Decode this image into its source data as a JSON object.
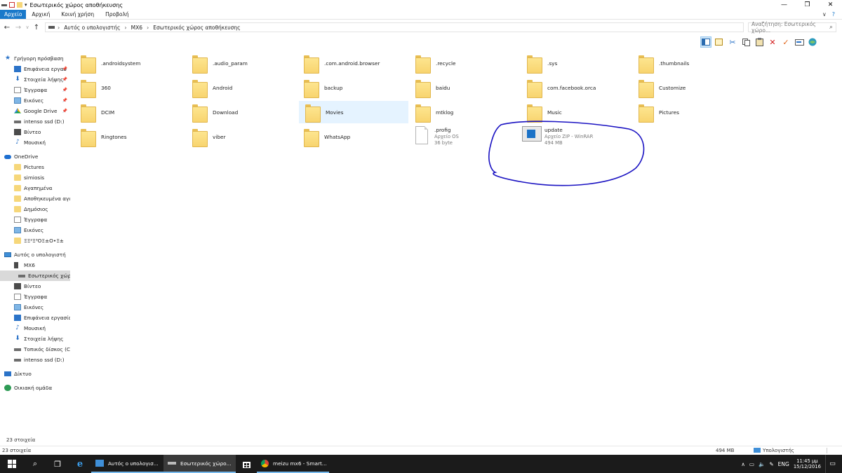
{
  "window": {
    "title": "Εσωτερικός χώρος αποθήκευσης",
    "minimize": "—",
    "maximize": "❐",
    "close": "✕"
  },
  "ribbon": {
    "tabs": [
      {
        "label": "Αρχείο"
      },
      {
        "label": "Αρχική"
      },
      {
        "label": "Κοινή χρήση"
      },
      {
        "label": "Προβολή"
      }
    ],
    "expand": "∨",
    "help": "?"
  },
  "navigation": {
    "back": "←",
    "forward": "→",
    "recent": "∨",
    "up": "↑"
  },
  "address": {
    "crumbs": [
      "Αυτός ο υπολογιστής",
      "MX6",
      "Εσωτερικός χώρος αποθήκευσης"
    ],
    "separator": "›"
  },
  "search": {
    "placeholder": "Αναζήτηση: Εσωτερικός χώρο...",
    "icon": "⌕"
  },
  "sidebar": {
    "quick_access": "Γρήγορη πρόσβαση",
    "items": [
      {
        "label": "Επιφάνεια εργασ",
        "pinned": true
      },
      {
        "label": "Στοιχεία λήψης",
        "pinned": true
      },
      {
        "label": "Έγγραφα",
        "pinned": true
      },
      {
        "label": "Εικόνες",
        "pinned": true
      },
      {
        "label": "Google Drive",
        "pinned": true
      },
      {
        "label": "intenso ssd (D:)"
      },
      {
        "label": "Βίντεο"
      },
      {
        "label": "Μουσική"
      }
    ],
    "onedrive": "OneDrive",
    "onedrive_items": [
      {
        "label": "Pictures"
      },
      {
        "label": "simiosis"
      },
      {
        "label": "Αγαπημένα"
      },
      {
        "label": "Αποθηκευμένα αγα"
      },
      {
        "label": "Δημόσιος"
      },
      {
        "label": "Έγγραφα"
      },
      {
        "label": "Εικόνες"
      },
      {
        "label": "ΞΞ²Ξ³ΟΞ±Ο•Ξ±"
      }
    ],
    "this_pc": "Αυτός ο υπολογιστή",
    "mx6": "MX6",
    "internal_storage": "Εσωτερικός χώρο",
    "pc_items": [
      {
        "label": "Βίντεο"
      },
      {
        "label": "Έγγραφα"
      },
      {
        "label": "Εικόνες"
      },
      {
        "label": "Επιφάνεια εργασίας"
      },
      {
        "label": "Μουσική"
      },
      {
        "label": "Στοιχεία λήψης"
      },
      {
        "label": "Τοπικός δίσκος (C:)"
      },
      {
        "label": "intenso ssd (D:)"
      }
    ],
    "network": "Δίκτυο",
    "homegroup": "Οικιακή ομάδα",
    "pin_glyph": "📌"
  },
  "files": [
    {
      "name": ".androidsystem",
      "kind": "folder"
    },
    {
      "name": ".audio_param",
      "kind": "folder"
    },
    {
      "name": ".com.android.browser",
      "kind": "folder"
    },
    {
      "name": ".recycle",
      "kind": "folder"
    },
    {
      "name": ".sys",
      "kind": "folder"
    },
    {
      "name": ".thumbnails",
      "kind": "folder"
    },
    {
      "name": "360",
      "kind": "folder"
    },
    {
      "name": "Android",
      "kind": "folder"
    },
    {
      "name": "backup",
      "kind": "folder"
    },
    {
      "name": "baidu",
      "kind": "folder"
    },
    {
      "name": "com.facebook.orca",
      "kind": "folder"
    },
    {
      "name": "Customize",
      "kind": "folder"
    },
    {
      "name": "DCIM",
      "kind": "folder"
    },
    {
      "name": "Download",
      "kind": "folder"
    },
    {
      "name": "Movies",
      "kind": "folder",
      "highlighted": true
    },
    {
      "name": "mtklog",
      "kind": "folder"
    },
    {
      "name": "Music",
      "kind": "folder"
    },
    {
      "name": "Pictures",
      "kind": "folder"
    },
    {
      "name": "Ringtones",
      "kind": "folder"
    },
    {
      "name": "viber",
      "kind": "folder"
    },
    {
      "name": "WhatsApp",
      "kind": "folder"
    },
    {
      "name": ".profig",
      "kind": "file",
      "type": "Αρχείο OS",
      "size": "36 byte"
    },
    {
      "name": "update",
      "kind": "rar",
      "type": "Αρχείο ZIP - WinRAR",
      "size": "494 MB"
    }
  ],
  "status": {
    "count_top": "23 στοιχεία",
    "count_bottom": "23 στοιχεία",
    "size": "494 MB",
    "location": "Υπολογιστής"
  },
  "taskbar": {
    "tasks": [
      {
        "label": "Αυτός ο υπολογισ..."
      },
      {
        "label": "Εσωτερικός χώρο..."
      },
      {
        "label": ""
      },
      {
        "label": "meizu mx6 - Smart..."
      }
    ],
    "search_glyph": "⌕",
    "taskview_glyph": "❐",
    "language": "ENG",
    "time": "11:45 μμ",
    "date": "15/12/2016",
    "notification_glyph": "▭",
    "tray_up": "∧",
    "tray_net": "▭",
    "tray_vol": "🔈",
    "tray_misc": "✎"
  },
  "colors": {
    "accent": "#1979ca",
    "annotation": "#1a12c2",
    "selection": "#d9d9d9",
    "hover": "#e5f3ff"
  }
}
